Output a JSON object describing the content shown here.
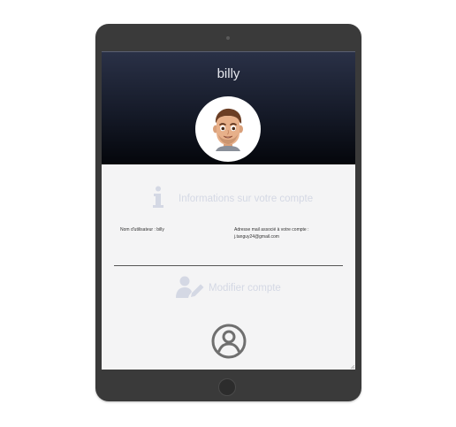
{
  "profile": {
    "username_display": "billy"
  },
  "info_section": {
    "title": "Informations sur votre compte",
    "username_field": "Nom d'utilisateur : billy",
    "email_label": "Adresse mail associé à votre compte :",
    "email_value": "j.tanguy24@gmail.com"
  },
  "modify_section": {
    "label": "Modifier compte"
  },
  "icons": {
    "info": "info-icon",
    "modify": "user-edit-icon",
    "account": "user-circle-icon",
    "avatar": "memoji-avatar"
  },
  "colors": {
    "header_top": "#2a3147",
    "header_bottom": "#04060b",
    "faded_text": "#d4d8e4",
    "device_frame": "#3a3a3a"
  }
}
